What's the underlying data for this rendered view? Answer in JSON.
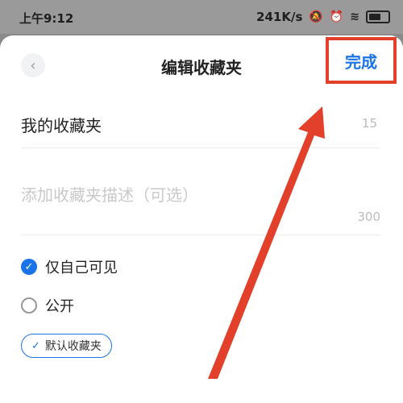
{
  "status_bar": {
    "time": "上午9:12",
    "network_speed": "241K/s",
    "icons": [
      "bell-off-icon",
      "alarm-icon",
      "hd-icon",
      "wifi-icon",
      "battery-icon"
    ]
  },
  "header": {
    "title": "编辑收藏夹",
    "back_icon": "‹",
    "done_label": "完成"
  },
  "form": {
    "name_value": "我的收藏夹",
    "name_limit": "15",
    "description_placeholder": "添加收藏夹描述（可选）",
    "description_limit": "300"
  },
  "visibility": {
    "options": [
      {
        "label": "仅自己可见",
        "checked": true
      },
      {
        "label": "公开",
        "checked": false
      }
    ]
  },
  "default_tag": {
    "label": "默认收藏夹"
  },
  "colors": {
    "accent": "#1a73e8",
    "highlight": "#e3402c"
  }
}
